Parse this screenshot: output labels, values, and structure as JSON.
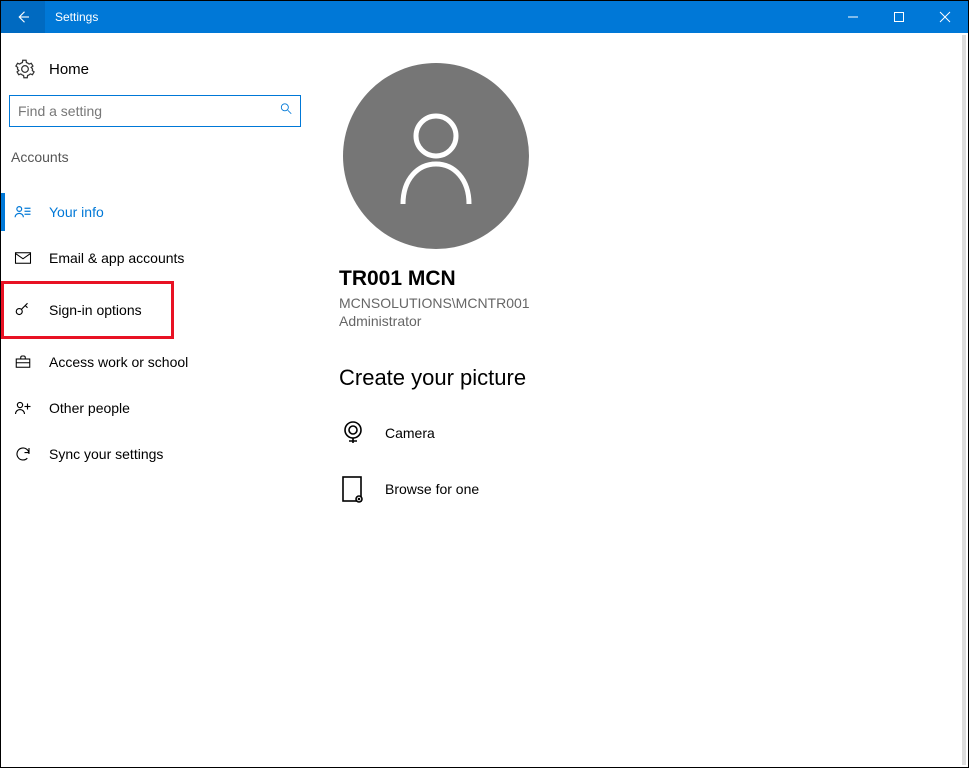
{
  "window": {
    "title": "Settings"
  },
  "sidebar": {
    "home": "Home",
    "search_placeholder": "Find a setting",
    "section": "Accounts",
    "items": [
      {
        "label": "Your info"
      },
      {
        "label": "Email & app accounts"
      },
      {
        "label": "Sign-in options"
      },
      {
        "label": "Access work or school"
      },
      {
        "label": "Other people"
      },
      {
        "label": "Sync your settings"
      }
    ]
  },
  "content": {
    "display_name": "TR001 MCN",
    "domain_user": "MCNSOLUTIONS\\MCNTR001",
    "role": "Administrator",
    "create_picture_heading": "Create your picture",
    "camera_label": "Camera",
    "browse_label": "Browse for one"
  },
  "colors": {
    "accent": "#0078d7",
    "highlight": "#e81123",
    "avatar_bg": "#767676"
  }
}
